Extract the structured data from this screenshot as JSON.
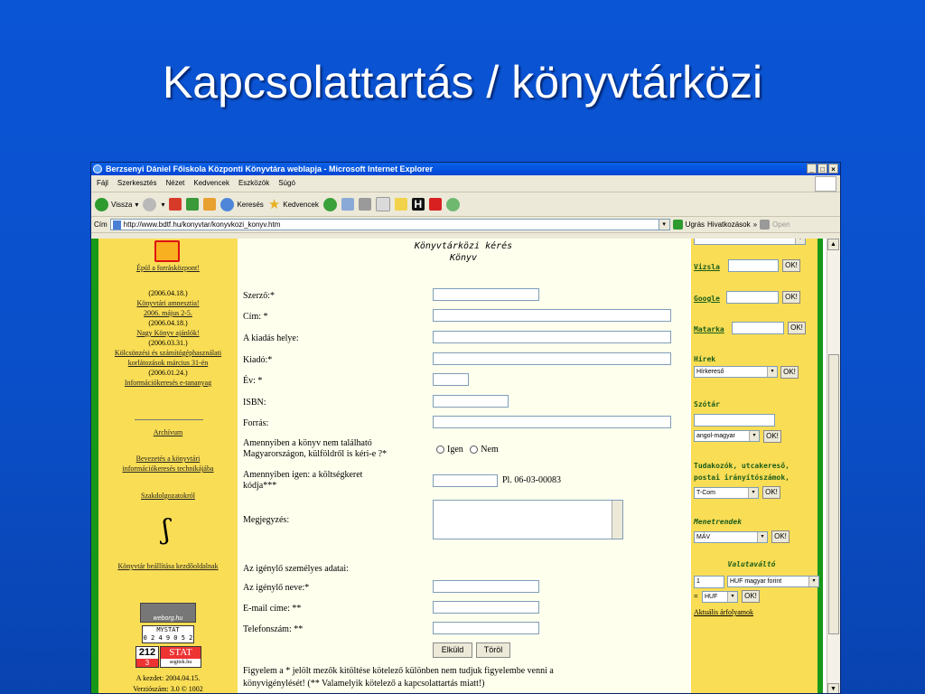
{
  "slide": {
    "title": "Kapcsolattartás / könyvtárközi"
  },
  "window": {
    "title": "Berzsenyi Dániel Főiskola Központi Könyvtára weblapja - Microsoft Internet Explorer"
  },
  "menu": [
    "Fájl",
    "Szerkesztés",
    "Nézet",
    "Kedvencek",
    "Eszközök",
    "Súgó"
  ],
  "toolbar": {
    "back": "Vissza",
    "search": "Keresés",
    "favorites": "Kedvencek"
  },
  "address": {
    "label": "Cím",
    "url": "http://www.bdtf.hu/konyvtar/konyvkozi_konyv.htm",
    "go": "Ugrás",
    "links": "Hivatkozások",
    "open": "Open"
  },
  "left": {
    "build": "Épül a forrásközpont!",
    "news": [
      {
        "date": "(2006.04.18.)",
        "links": [
          "Könyvtári amnesztia!",
          "2006. május 2-5."
        ]
      },
      {
        "date": "(2006.04.18.)",
        "links": [
          "Nagy Könyv ajánlók!"
        ]
      },
      {
        "date": "(2006.03.31.)",
        "links": [
          "Kölcsönzési és számítógéphasználati",
          "korlátozások március 31-én"
        ]
      },
      {
        "date": "(2006.01.24.)",
        "links": [
          "Információkeresés e-tananyag"
        ]
      }
    ],
    "archive": "Archívum",
    "intro1": "Bevezetés a könyvtári",
    "intro2": "információkeresés technikájába",
    "thesis": "Szakdolgozatokról",
    "settings": "Könyvtár beállítása kezdőoldalnak",
    "counter_brand": "weborg.hu",
    "mystat_label": "MYSTAT",
    "mystat_number": "0 2 4 9 0 5 2",
    "stat_left_top": "212",
    "stat_left_bottom": "3",
    "stat_right_top": "STAT",
    "stat_right_bottom": "segitek.hu",
    "start_date": "A kezdet: 2004.04.15.",
    "version": "Verziószám: 3.0 © 1002"
  },
  "form": {
    "heading1": "Könyvtárközi kérés",
    "heading2": "Könyv",
    "author": "Szerző:*",
    "title": "Cím: *",
    "place": "A kiadás helye:",
    "publisher": "Kiadó:*",
    "year": "Év: *",
    "isbn": "ISBN:",
    "source": "Forrás:",
    "not_found1": "Amennyiben a könyv nem található",
    "not_found2": "Magyarországon, külföldről is kéri-e ?*",
    "yes": "Igen",
    "no": "Nem",
    "cost1": "Amennyiben igen: a költségkeret",
    "cost2": "kódja***",
    "cost_example": "Pl. 06-03-00083",
    "note": "Megjegyzés:",
    "personal": "Az igénylő személyes adatai:",
    "name": "Az igénylő neve:*",
    "email": "E-mail címe: **",
    "phone": "Telefonszám: **",
    "submit": "Elküld",
    "reset": "Töröl",
    "footer1": "Figyelem a * jelölt mezők kitöltése kötelező különben nem tudjuk figyelembe venni a",
    "footer2": "könyvigénylését! (** Valamelyik kötelező a kapcsolattartás miatt!)"
  },
  "right": {
    "vizsla": "Vizsla",
    "google": "Google",
    "matarka": "Matarka",
    "ok": "OK!",
    "hirek": "Hírek",
    "hirek_select": "Hírkereső",
    "szotar": "Szótár",
    "szotar_select": "angol-magyar",
    "tudakozo1": "Tudakozók, utcakereső,",
    "tudakozo2": "postai irányítószámok,",
    "tudakozo_select": "T-Com",
    "menetrend": "Menetrendek",
    "menetrend_select": "MÁV",
    "valuta": "Valutaváltó",
    "amount": "1",
    "currency_from": "HUF magyar forint",
    "eq": "=",
    "currency_to": "HUF",
    "rates": "Aktuális árfolyamok"
  }
}
